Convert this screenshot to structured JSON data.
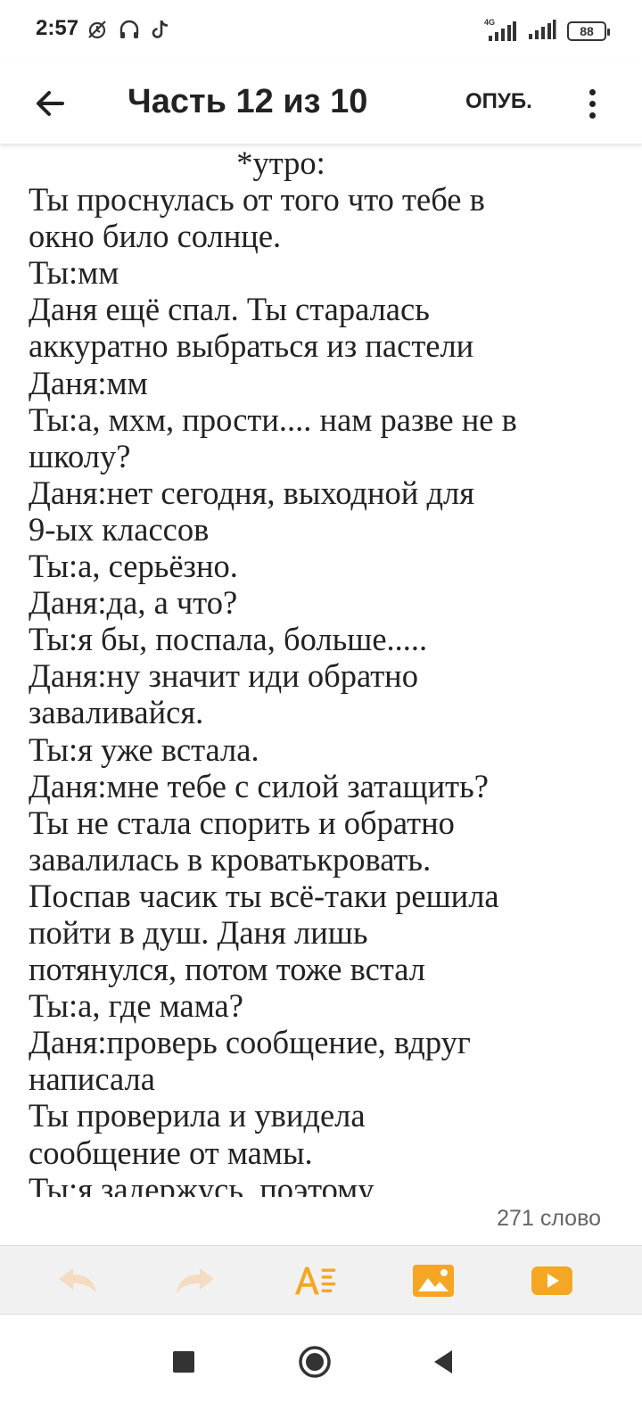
{
  "status_bar": {
    "time": "2:57",
    "network": "4G",
    "battery": "88"
  },
  "toolbar": {
    "title": "Часть 12 из 10",
    "publish_label": "ОПУБ."
  },
  "editor": {
    "lines": [
      "*утро:",
      "Ты проснулась от того что тебе в",
      "окно било солнце.",
      "Ты:мм",
      "Даня ещё спал. Ты старалась",
      "аккуратно выбраться из пастели",
      "Даня:мм",
      "Ты:а, мхм, прости.... нам разве не в",
      "школу?",
      "Даня:нет сегодня, выходной для",
      "9-ых классов",
      "Ты:а, серьёзно.",
      "Даня:да, а что?",
      "Ты:я бы, поспала, больше.....",
      "Даня:ну значит иди обратно",
      "заваливайся.",
      "Ты:я уже встала.",
      "Даня:мне тебе с силой затащить?",
      "Ты не стала спорить и обратно",
      "завалилась в кроватькровать.",
      "Поспав часик ты всё-таки решила",
      "пойти в душ. Даня лишь",
      "потянулся, потом тоже встал",
      "Ты:а, где мама?",
      "Даня:проверь сообщение, вдруг",
      "написала",
      "Ты проверила и увидела",
      "сообщение от мамы.",
      "Ты:я задержусь, поэтому"
    ]
  },
  "word_count": "271 слово",
  "icons": {
    "undo": "undo-icon",
    "redo": "redo-icon",
    "format": "text-format-icon",
    "image": "insert-image-icon",
    "video": "insert-video-icon"
  },
  "colors": {
    "accent": "#F5A623",
    "disabled": "#F3DCC0",
    "text": "#222222"
  }
}
